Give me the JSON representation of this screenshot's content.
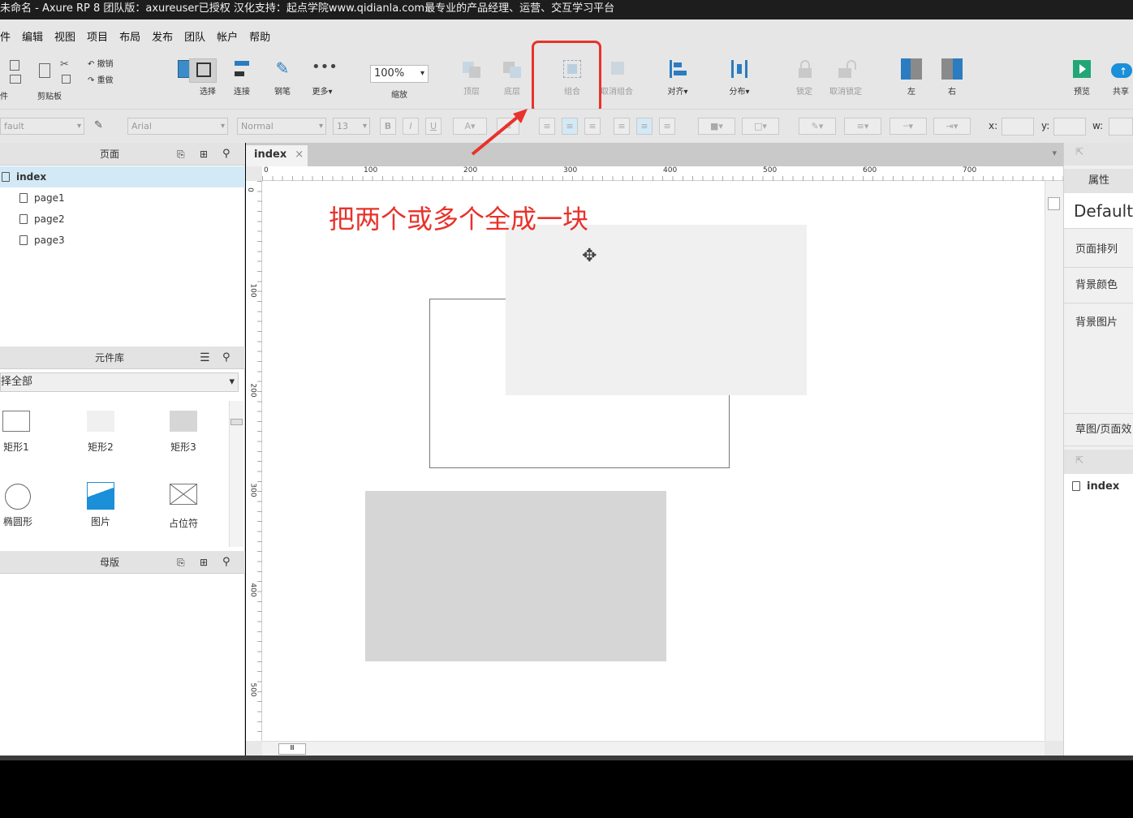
{
  "window": {
    "title": "未命名 - Axure RP 8 团队版：axureuser已授权 汉化支持：起点学院www.qidianla.com最专业的产品经理、运营、交互学习平台"
  },
  "menu": [
    "件",
    "编辑",
    "视图",
    "项目",
    "布局",
    "发布",
    "团队",
    "帐户",
    "帮助"
  ],
  "toolbar": {
    "clipboard_label": "剪贴板",
    "file_partial": "件",
    "undo": "撤销",
    "redo": "重做",
    "select": "选择",
    "connect": "连接",
    "pen": "钢笔",
    "more": "更多▾",
    "zoom_value": "100%",
    "zoom_label": "缩放",
    "top": "顶层",
    "bottom": "底层",
    "group": "组合",
    "ungroup": "取消组合",
    "align": "对齐▾",
    "distribute": "分布▾",
    "lock": "锁定",
    "unlock": "取消锁定",
    "left": "左",
    "right": "右",
    "preview": "预览",
    "share": "共享"
  },
  "format": {
    "style": "fault",
    "font": "Arial",
    "weight": "Normal",
    "size": "13",
    "x_label": "x:",
    "y_label": "y:",
    "w_label": "w:"
  },
  "pages_panel": {
    "title": "页面",
    "root": "index",
    "children": [
      "page1",
      "page2",
      "page3"
    ]
  },
  "library_panel": {
    "title": "元件库",
    "filter": "择全部",
    "items": [
      "矩形1",
      "矩形2",
      "矩形3",
      "椭圆形",
      "图片",
      "占位符"
    ]
  },
  "masters_panel": {
    "title": "母版"
  },
  "canvas": {
    "tab": "index",
    "annotation": "把两个或多个全成一块",
    "ruler_h": [
      "0",
      "100",
      "200",
      "300",
      "400",
      "500",
      "600",
      "700"
    ],
    "ruler_v": [
      "0",
      "100",
      "200",
      "300",
      "400",
      "500"
    ]
  },
  "right_panel": {
    "tab": "属性",
    "style": "Default",
    "items": [
      "页面排列",
      "背景颜色",
      "背景图片"
    ],
    "sketch": "草图/页面效",
    "outline_item": "index"
  },
  "colors": {
    "highlight": "#e8322b",
    "accent": "#1b8fd8",
    "selected_row": "#d3e9f6"
  }
}
